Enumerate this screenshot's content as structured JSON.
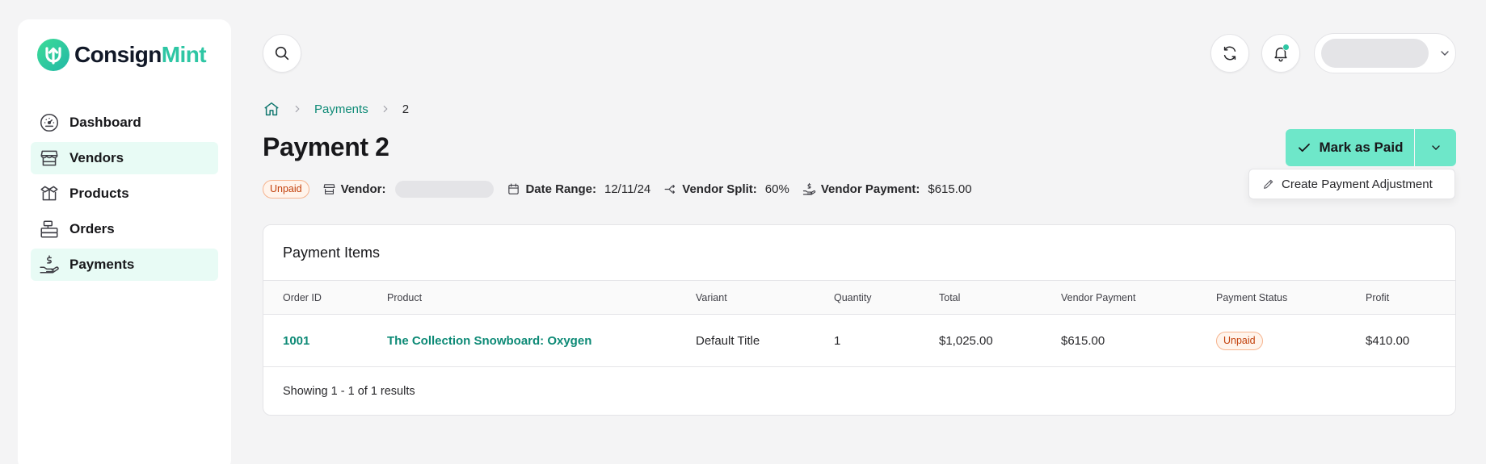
{
  "brand": {
    "name_part1": "Consign",
    "name_part2": "Mint",
    "accent": "#2ec6a4"
  },
  "sidebar": {
    "items": [
      {
        "label": "Dashboard",
        "icon": "gauge-icon",
        "active": false
      },
      {
        "label": "Vendors",
        "icon": "store-icon",
        "active": true
      },
      {
        "label": "Products",
        "icon": "box-icon",
        "active": false
      },
      {
        "label": "Orders",
        "icon": "cash-register-icon",
        "active": false
      },
      {
        "label": "Payments",
        "icon": "hand-coins-icon",
        "active": true
      }
    ]
  },
  "topbar": {
    "notification_dot_color": "#2ec6a4"
  },
  "breadcrumb": {
    "items": [
      "Payments",
      "2"
    ]
  },
  "page": {
    "title": "Payment 2"
  },
  "meta": {
    "status": "Unpaid",
    "vendor_label": "Vendor:",
    "date_range_label": "Date Range:",
    "date_range_value": "12/11/24",
    "vendor_split_label": "Vendor Split:",
    "vendor_split_value": "60%",
    "vendor_payment_label": "Vendor Payment:",
    "vendor_payment_value": "$615.00"
  },
  "actions": {
    "mark_paid_label": "Mark as Paid",
    "dropdown_item": "Create Payment Adjustment"
  },
  "table": {
    "title": "Payment Items",
    "columns": [
      "Order ID",
      "Product",
      "Variant",
      "Quantity",
      "Total",
      "Vendor Payment",
      "Payment Status",
      "Profit"
    ],
    "rows": [
      {
        "order_id": "1001",
        "product": "The Collection Snowboard: Oxygen",
        "variant": "Default Title",
        "quantity": "1",
        "total": "$1,025.00",
        "vendor_payment": "$615.00",
        "payment_status": "Unpaid",
        "profit": "$410.00"
      }
    ],
    "footer": "Showing 1 - 1 of 1 results"
  }
}
